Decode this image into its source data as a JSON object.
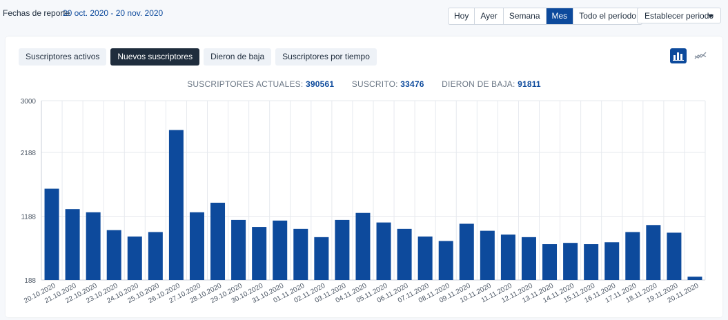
{
  "header": {
    "range_label": "Fechas de reporte",
    "range_value": "20 oct. 2020 - 20 nov. 2020",
    "periods": [
      "Hoy",
      "Ayer",
      "Semana",
      "Mes",
      "Todo el período"
    ],
    "active_period": "Mes",
    "set_period_label": "Establecer periodo"
  },
  "tabs": [
    "Suscriptores activos",
    "Nuevos suscriptores",
    "Dieron de baja",
    "Suscriptores por tiempo"
  ],
  "active_tab": "Nuevos suscriptores",
  "view_toggle": {
    "active": "bar-chart-icon",
    "icons": [
      "bar-chart-icon",
      "line-chart-icon"
    ]
  },
  "stats": {
    "current_label": "SUSCRIPTORES ACTUALES:",
    "current_value": "390561",
    "subscribed_label": "SUSCRITO:",
    "subscribed_value": "33476",
    "unsubscribed_label": "DIERON DE BAJA:",
    "unsubscribed_value": "91811"
  },
  "colors": {
    "accent": "#0d4a9c",
    "dark": "#1f2d3d",
    "grid": "#e6e9ee"
  },
  "chart_data": {
    "type": "bar",
    "title": "",
    "xlabel": "",
    "ylabel": "",
    "ylim": [
      188,
      3000
    ],
    "yticks": [
      "188",
      "1188",
      "2188",
      "3000"
    ],
    "grid": true,
    "categories": [
      "20.10.2020",
      "21.10.2020",
      "22.10.2020",
      "23.10.2020",
      "24.10.2020",
      "25.10.2020",
      "26.10.2020",
      "27.10.2020",
      "28.10.2020",
      "29.10.2020",
      "30.10.2020",
      "31.10.2020",
      "01.11.2020",
      "02.11.2020",
      "03.11.2020",
      "04.11.2020",
      "05.11.2020",
      "06.11.2020",
      "07.11.2020",
      "08.11.2020",
      "09.11.2020",
      "10.11.2020",
      "11.11.2020",
      "12.11.2020",
      "13.11.2020",
      "14.11.2020",
      "15.11.2020",
      "16.11.2020",
      "17.11.2020",
      "18.11.2020",
      "19.11.2020",
      "20.11.2020"
    ],
    "values": [
      1620,
      1300,
      1250,
      970,
      870,
      940,
      2540,
      1250,
      1400,
      1130,
      1020,
      1120,
      990,
      860,
      1130,
      1240,
      1090,
      990,
      870,
      800,
      1070,
      960,
      900,
      860,
      750,
      770,
      750,
      780,
      940,
      1050,
      930,
      240
    ]
  }
}
